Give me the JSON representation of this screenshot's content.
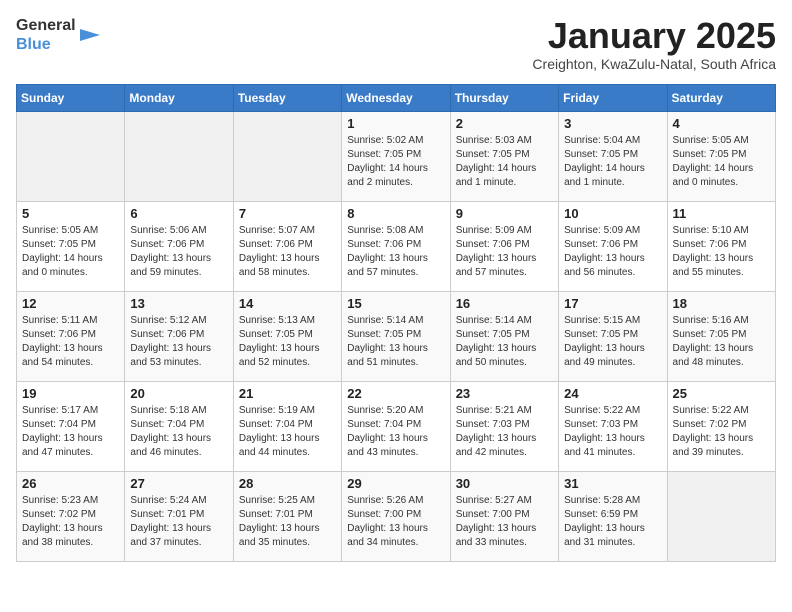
{
  "logo": {
    "line1": "General",
    "line2": "Blue"
  },
  "title": "January 2025",
  "subtitle": "Creighton, KwaZulu-Natal, South Africa",
  "weekdays": [
    "Sunday",
    "Monday",
    "Tuesday",
    "Wednesday",
    "Thursday",
    "Friday",
    "Saturday"
  ],
  "weeks": [
    [
      {
        "day": "",
        "info": ""
      },
      {
        "day": "",
        "info": ""
      },
      {
        "day": "",
        "info": ""
      },
      {
        "day": "1",
        "info": "Sunrise: 5:02 AM\nSunset: 7:05 PM\nDaylight: 14 hours and 2 minutes."
      },
      {
        "day": "2",
        "info": "Sunrise: 5:03 AM\nSunset: 7:05 PM\nDaylight: 14 hours and 1 minute."
      },
      {
        "day": "3",
        "info": "Sunrise: 5:04 AM\nSunset: 7:05 PM\nDaylight: 14 hours and 1 minute."
      },
      {
        "day": "4",
        "info": "Sunrise: 5:05 AM\nSunset: 7:05 PM\nDaylight: 14 hours and 0 minutes."
      }
    ],
    [
      {
        "day": "5",
        "info": "Sunrise: 5:05 AM\nSunset: 7:05 PM\nDaylight: 14 hours and 0 minutes."
      },
      {
        "day": "6",
        "info": "Sunrise: 5:06 AM\nSunset: 7:06 PM\nDaylight: 13 hours and 59 minutes."
      },
      {
        "day": "7",
        "info": "Sunrise: 5:07 AM\nSunset: 7:06 PM\nDaylight: 13 hours and 58 minutes."
      },
      {
        "day": "8",
        "info": "Sunrise: 5:08 AM\nSunset: 7:06 PM\nDaylight: 13 hours and 57 minutes."
      },
      {
        "day": "9",
        "info": "Sunrise: 5:09 AM\nSunset: 7:06 PM\nDaylight: 13 hours and 57 minutes."
      },
      {
        "day": "10",
        "info": "Sunrise: 5:09 AM\nSunset: 7:06 PM\nDaylight: 13 hours and 56 minutes."
      },
      {
        "day": "11",
        "info": "Sunrise: 5:10 AM\nSunset: 7:06 PM\nDaylight: 13 hours and 55 minutes."
      }
    ],
    [
      {
        "day": "12",
        "info": "Sunrise: 5:11 AM\nSunset: 7:06 PM\nDaylight: 13 hours and 54 minutes."
      },
      {
        "day": "13",
        "info": "Sunrise: 5:12 AM\nSunset: 7:06 PM\nDaylight: 13 hours and 53 minutes."
      },
      {
        "day": "14",
        "info": "Sunrise: 5:13 AM\nSunset: 7:05 PM\nDaylight: 13 hours and 52 minutes."
      },
      {
        "day": "15",
        "info": "Sunrise: 5:14 AM\nSunset: 7:05 PM\nDaylight: 13 hours and 51 minutes."
      },
      {
        "day": "16",
        "info": "Sunrise: 5:14 AM\nSunset: 7:05 PM\nDaylight: 13 hours and 50 minutes."
      },
      {
        "day": "17",
        "info": "Sunrise: 5:15 AM\nSunset: 7:05 PM\nDaylight: 13 hours and 49 minutes."
      },
      {
        "day": "18",
        "info": "Sunrise: 5:16 AM\nSunset: 7:05 PM\nDaylight: 13 hours and 48 minutes."
      }
    ],
    [
      {
        "day": "19",
        "info": "Sunrise: 5:17 AM\nSunset: 7:04 PM\nDaylight: 13 hours and 47 minutes."
      },
      {
        "day": "20",
        "info": "Sunrise: 5:18 AM\nSunset: 7:04 PM\nDaylight: 13 hours and 46 minutes."
      },
      {
        "day": "21",
        "info": "Sunrise: 5:19 AM\nSunset: 7:04 PM\nDaylight: 13 hours and 44 minutes."
      },
      {
        "day": "22",
        "info": "Sunrise: 5:20 AM\nSunset: 7:04 PM\nDaylight: 13 hours and 43 minutes."
      },
      {
        "day": "23",
        "info": "Sunrise: 5:21 AM\nSunset: 7:03 PM\nDaylight: 13 hours and 42 minutes."
      },
      {
        "day": "24",
        "info": "Sunrise: 5:22 AM\nSunset: 7:03 PM\nDaylight: 13 hours and 41 minutes."
      },
      {
        "day": "25",
        "info": "Sunrise: 5:22 AM\nSunset: 7:02 PM\nDaylight: 13 hours and 39 minutes."
      }
    ],
    [
      {
        "day": "26",
        "info": "Sunrise: 5:23 AM\nSunset: 7:02 PM\nDaylight: 13 hours and 38 minutes."
      },
      {
        "day": "27",
        "info": "Sunrise: 5:24 AM\nSunset: 7:01 PM\nDaylight: 13 hours and 37 minutes."
      },
      {
        "day": "28",
        "info": "Sunrise: 5:25 AM\nSunset: 7:01 PM\nDaylight: 13 hours and 35 minutes."
      },
      {
        "day": "29",
        "info": "Sunrise: 5:26 AM\nSunset: 7:00 PM\nDaylight: 13 hours and 34 minutes."
      },
      {
        "day": "30",
        "info": "Sunrise: 5:27 AM\nSunset: 7:00 PM\nDaylight: 13 hours and 33 minutes."
      },
      {
        "day": "31",
        "info": "Sunrise: 5:28 AM\nSunset: 6:59 PM\nDaylight: 13 hours and 31 minutes."
      },
      {
        "day": "",
        "info": ""
      }
    ]
  ]
}
